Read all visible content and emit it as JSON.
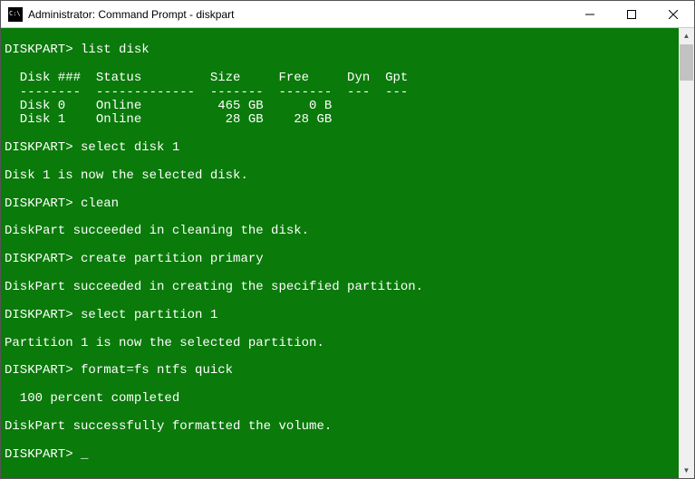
{
  "window": {
    "title": "Administrator: Command Prompt - diskpart"
  },
  "terminal": {
    "prompt": "DISKPART>",
    "lines": {
      "cmd1": "list disk",
      "header": "  Disk ###  Status         Size     Free     Dyn  Gpt",
      "divider": "  --------  -------------  -------  -------  ---  ---",
      "row0": "  Disk 0    Online          465 GB      0 B",
      "row1": "  Disk 1    Online           28 GB    28 GB",
      "cmd2": "select disk 1",
      "resp2": "Disk 1 is now the selected disk.",
      "cmd3": "clean",
      "resp3": "DiskPart succeeded in cleaning the disk.",
      "cmd4": "create partition primary",
      "resp4": "DiskPart succeeded in creating the specified partition.",
      "cmd5": "select partition 1",
      "resp5": "Partition 1 is now the selected partition.",
      "cmd6": "format=fs ntfs quick",
      "progress": "  100 percent completed",
      "resp6": "DiskPart successfully formatted the volume.",
      "cursor": "_"
    }
  }
}
